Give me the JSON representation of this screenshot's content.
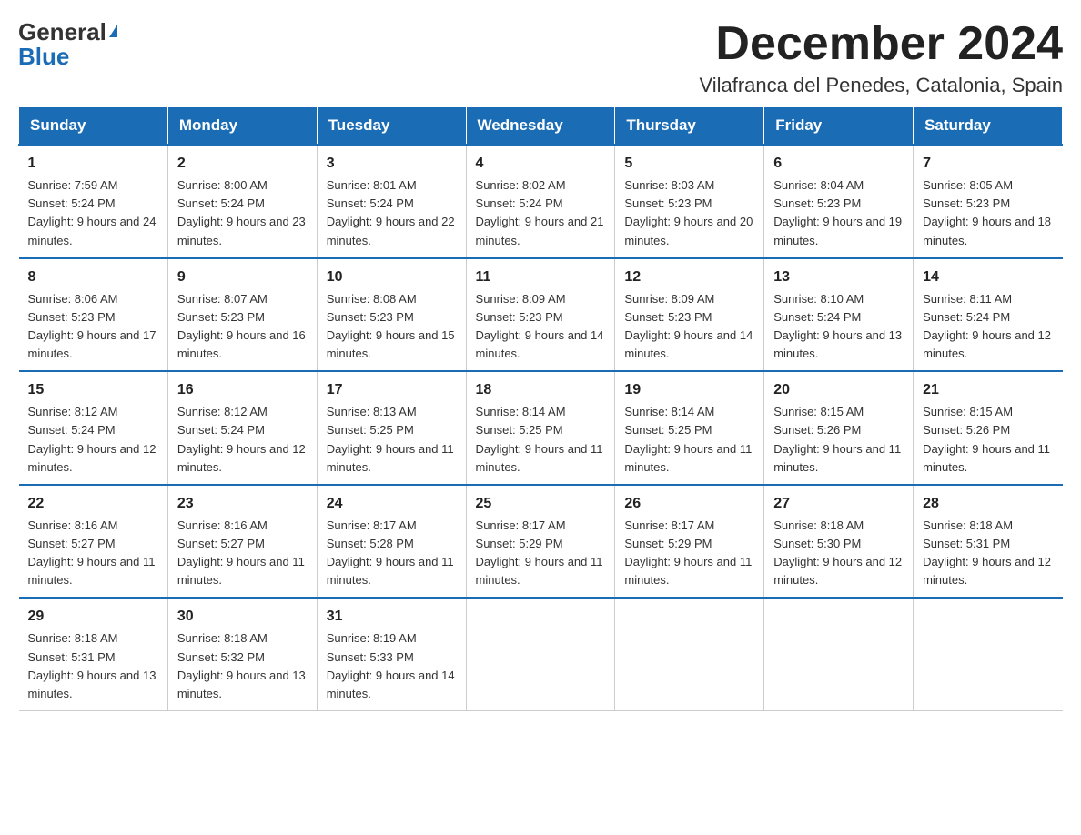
{
  "header": {
    "logo_general": "General",
    "logo_blue": "Blue",
    "month_title": "December 2024",
    "location": "Vilafranca del Penedes, Catalonia, Spain"
  },
  "days_of_week": [
    "Sunday",
    "Monday",
    "Tuesday",
    "Wednesday",
    "Thursday",
    "Friday",
    "Saturday"
  ],
  "weeks": [
    [
      {
        "day": 1,
        "sunrise": "7:59 AM",
        "sunset": "5:24 PM",
        "daylight": "9 hours and 24 minutes."
      },
      {
        "day": 2,
        "sunrise": "8:00 AM",
        "sunset": "5:24 PM",
        "daylight": "9 hours and 23 minutes."
      },
      {
        "day": 3,
        "sunrise": "8:01 AM",
        "sunset": "5:24 PM",
        "daylight": "9 hours and 22 minutes."
      },
      {
        "day": 4,
        "sunrise": "8:02 AM",
        "sunset": "5:24 PM",
        "daylight": "9 hours and 21 minutes."
      },
      {
        "day": 5,
        "sunrise": "8:03 AM",
        "sunset": "5:23 PM",
        "daylight": "9 hours and 20 minutes."
      },
      {
        "day": 6,
        "sunrise": "8:04 AM",
        "sunset": "5:23 PM",
        "daylight": "9 hours and 19 minutes."
      },
      {
        "day": 7,
        "sunrise": "8:05 AM",
        "sunset": "5:23 PM",
        "daylight": "9 hours and 18 minutes."
      }
    ],
    [
      {
        "day": 8,
        "sunrise": "8:06 AM",
        "sunset": "5:23 PM",
        "daylight": "9 hours and 17 minutes."
      },
      {
        "day": 9,
        "sunrise": "8:07 AM",
        "sunset": "5:23 PM",
        "daylight": "9 hours and 16 minutes."
      },
      {
        "day": 10,
        "sunrise": "8:08 AM",
        "sunset": "5:23 PM",
        "daylight": "9 hours and 15 minutes."
      },
      {
        "day": 11,
        "sunrise": "8:09 AM",
        "sunset": "5:23 PM",
        "daylight": "9 hours and 14 minutes."
      },
      {
        "day": 12,
        "sunrise": "8:09 AM",
        "sunset": "5:23 PM",
        "daylight": "9 hours and 14 minutes."
      },
      {
        "day": 13,
        "sunrise": "8:10 AM",
        "sunset": "5:24 PM",
        "daylight": "9 hours and 13 minutes."
      },
      {
        "day": 14,
        "sunrise": "8:11 AM",
        "sunset": "5:24 PM",
        "daylight": "9 hours and 12 minutes."
      }
    ],
    [
      {
        "day": 15,
        "sunrise": "8:12 AM",
        "sunset": "5:24 PM",
        "daylight": "9 hours and 12 minutes."
      },
      {
        "day": 16,
        "sunrise": "8:12 AM",
        "sunset": "5:24 PM",
        "daylight": "9 hours and 12 minutes."
      },
      {
        "day": 17,
        "sunrise": "8:13 AM",
        "sunset": "5:25 PM",
        "daylight": "9 hours and 11 minutes."
      },
      {
        "day": 18,
        "sunrise": "8:14 AM",
        "sunset": "5:25 PM",
        "daylight": "9 hours and 11 minutes."
      },
      {
        "day": 19,
        "sunrise": "8:14 AM",
        "sunset": "5:25 PM",
        "daylight": "9 hours and 11 minutes."
      },
      {
        "day": 20,
        "sunrise": "8:15 AM",
        "sunset": "5:26 PM",
        "daylight": "9 hours and 11 minutes."
      },
      {
        "day": 21,
        "sunrise": "8:15 AM",
        "sunset": "5:26 PM",
        "daylight": "9 hours and 11 minutes."
      }
    ],
    [
      {
        "day": 22,
        "sunrise": "8:16 AM",
        "sunset": "5:27 PM",
        "daylight": "9 hours and 11 minutes."
      },
      {
        "day": 23,
        "sunrise": "8:16 AM",
        "sunset": "5:27 PM",
        "daylight": "9 hours and 11 minutes."
      },
      {
        "day": 24,
        "sunrise": "8:17 AM",
        "sunset": "5:28 PM",
        "daylight": "9 hours and 11 minutes."
      },
      {
        "day": 25,
        "sunrise": "8:17 AM",
        "sunset": "5:29 PM",
        "daylight": "9 hours and 11 minutes."
      },
      {
        "day": 26,
        "sunrise": "8:17 AM",
        "sunset": "5:29 PM",
        "daylight": "9 hours and 11 minutes."
      },
      {
        "day": 27,
        "sunrise": "8:18 AM",
        "sunset": "5:30 PM",
        "daylight": "9 hours and 12 minutes."
      },
      {
        "day": 28,
        "sunrise": "8:18 AM",
        "sunset": "5:31 PM",
        "daylight": "9 hours and 12 minutes."
      }
    ],
    [
      {
        "day": 29,
        "sunrise": "8:18 AM",
        "sunset": "5:31 PM",
        "daylight": "9 hours and 13 minutes."
      },
      {
        "day": 30,
        "sunrise": "8:18 AM",
        "sunset": "5:32 PM",
        "daylight": "9 hours and 13 minutes."
      },
      {
        "day": 31,
        "sunrise": "8:19 AM",
        "sunset": "5:33 PM",
        "daylight": "9 hours and 14 minutes."
      },
      null,
      null,
      null,
      null
    ]
  ]
}
